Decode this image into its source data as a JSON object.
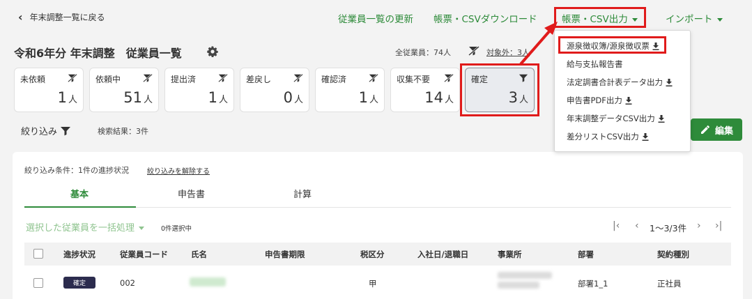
{
  "nav": {
    "back_label": "年末調整一覧に戻る",
    "refresh_label": "従業員一覧の更新",
    "download_label": "帳票・CSVダウンロード",
    "output_label": "帳票・CSV出力",
    "import_label": "インポート"
  },
  "page": {
    "title": "令和6年分 年末調整　従業員一覧"
  },
  "summary": {
    "total": "全従業員：74人",
    "excluded": "対象外：3人"
  },
  "cards": [
    {
      "label": "未依頼",
      "count": "1",
      "unit": "人"
    },
    {
      "label": "依頼中",
      "count": "51",
      "unit": "人"
    },
    {
      "label": "提出済",
      "count": "1",
      "unit": "人"
    },
    {
      "label": "差戻し",
      "count": "0",
      "unit": "人"
    },
    {
      "label": "確認済",
      "count": "1",
      "unit": "人"
    },
    {
      "label": "収集不要",
      "count": "14",
      "unit": "人"
    },
    {
      "label": "確定",
      "count": "3",
      "unit": "人"
    }
  ],
  "filter": {
    "label": "絞り込み",
    "result": "検索結果：3件"
  },
  "edit_label": "編集",
  "dropdown": {
    "items": [
      "源泉徴収簿/源泉徴収票",
      "給与支払報告書",
      "法定調書合計表データ出力",
      "申告書PDF出力",
      "年末調整データCSV出力",
      "差分リストCSV出力"
    ]
  },
  "conditions": {
    "text": "絞り込み条件：1件の進捗状況",
    "clear": "絞り込みを解除する"
  },
  "tabs": [
    "基本",
    "申告書",
    "計算"
  ],
  "bulk": {
    "label": "選択した従業員を一括処理",
    "selected": "0件選択中"
  },
  "pagination": {
    "range": "1〜3/3件"
  },
  "table": {
    "headers": [
      "進捗状況",
      "従業員コード",
      "氏名",
      "申告書期限",
      "税区分",
      "入社日/退職日",
      "事業所",
      "部署",
      "契約種別"
    ],
    "rows": [
      {
        "status": "確定",
        "code": "002",
        "tax": "甲",
        "dept": "部署1_1",
        "contract": "正社員"
      }
    ]
  },
  "colors": {
    "accent": "#2e8b3a",
    "highlight": "#e01b1b",
    "badge": "#2c2c4e"
  }
}
